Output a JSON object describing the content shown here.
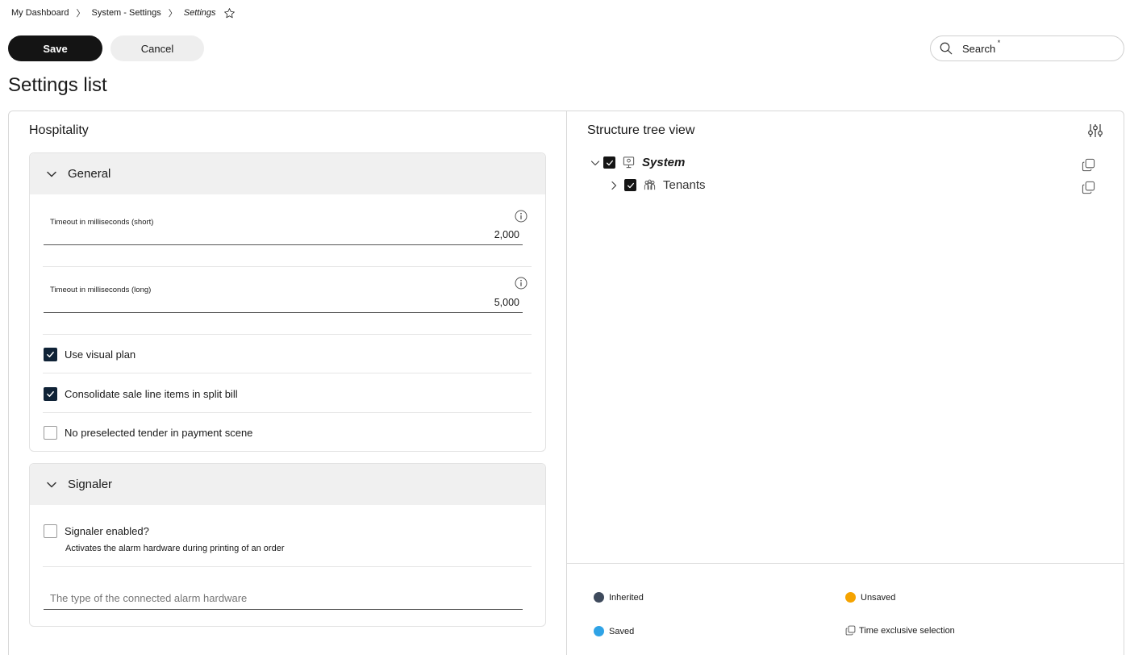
{
  "breadcrumb": {
    "items": [
      "My Dashboard",
      "System - Settings"
    ],
    "current": "Settings",
    "separator": "〉"
  },
  "toolbar": {
    "save_label": "Save",
    "cancel_label": "Cancel"
  },
  "search": {
    "placeholder": "Search",
    "required_mark": "*"
  },
  "page": {
    "title": "Settings list"
  },
  "left_panel": {
    "title": "Hospitality",
    "general": {
      "label": "General",
      "fields": [
        {
          "label": "Timeout in milliseconds (short)",
          "value": "2,000"
        },
        {
          "label": "Timeout in milliseconds (long)",
          "value": "5,000"
        }
      ],
      "checkboxes": [
        {
          "label": "Use visual plan",
          "checked": true
        },
        {
          "label": "Consolidate sale line items in split bill",
          "checked": true
        },
        {
          "label": "No preselected tender in payment scene",
          "checked": false
        }
      ]
    },
    "signaler": {
      "label": "Signaler",
      "checkbox": {
        "label": "Signaler enabled?",
        "checked": false
      },
      "description": "Activates the alarm hardware during printing of an order",
      "hardware_placeholder": "The type of the connected alarm hardware"
    }
  },
  "right_panel": {
    "title": "Structure tree view",
    "tree": [
      {
        "label": "System",
        "checked": true,
        "expanded": true,
        "icon": "system-icon"
      },
      {
        "label": "Tenants",
        "checked": true,
        "expanded": false,
        "icon": "tenants-icon"
      }
    ],
    "legend": [
      {
        "label": "Inherited",
        "color": "#3e4a5c"
      },
      {
        "label": "Unsaved",
        "color": "#f5a300"
      },
      {
        "label": "Saved",
        "color": "#2fa3e6"
      },
      {
        "label": "Time exclusive selection",
        "icon": "copy-icon"
      }
    ]
  },
  "colors": {
    "primary": "#141414",
    "checkbox_checked": "#0f2236",
    "header_bg": "#f0f0f0"
  }
}
